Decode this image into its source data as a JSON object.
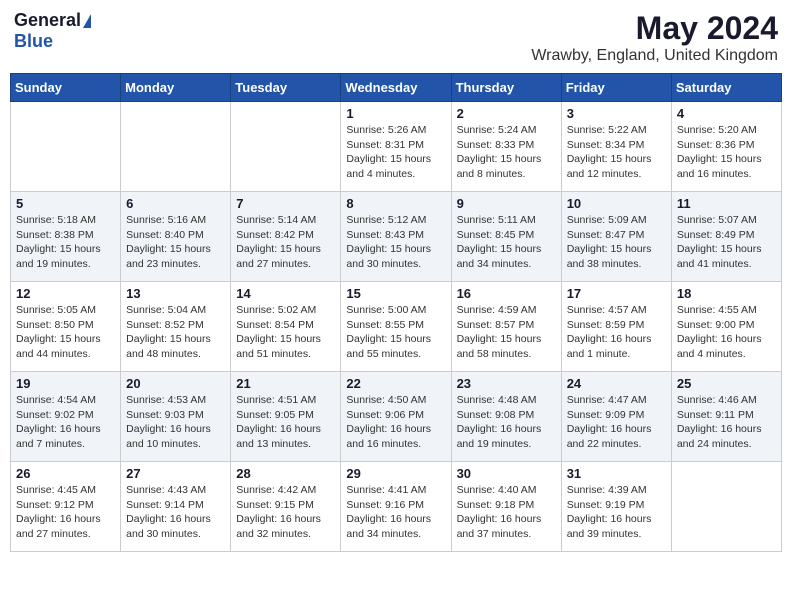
{
  "header": {
    "logo_general": "General",
    "logo_blue": "Blue",
    "month_title": "May 2024",
    "location": "Wrawby, England, United Kingdom"
  },
  "weekdays": [
    "Sunday",
    "Monday",
    "Tuesday",
    "Wednesday",
    "Thursday",
    "Friday",
    "Saturday"
  ],
  "weeks": [
    [
      {
        "day": "",
        "info": ""
      },
      {
        "day": "",
        "info": ""
      },
      {
        "day": "",
        "info": ""
      },
      {
        "day": "1",
        "info": "Sunrise: 5:26 AM\nSunset: 8:31 PM\nDaylight: 15 hours\nand 4 minutes."
      },
      {
        "day": "2",
        "info": "Sunrise: 5:24 AM\nSunset: 8:33 PM\nDaylight: 15 hours\nand 8 minutes."
      },
      {
        "day": "3",
        "info": "Sunrise: 5:22 AM\nSunset: 8:34 PM\nDaylight: 15 hours\nand 12 minutes."
      },
      {
        "day": "4",
        "info": "Sunrise: 5:20 AM\nSunset: 8:36 PM\nDaylight: 15 hours\nand 16 minutes."
      }
    ],
    [
      {
        "day": "5",
        "info": "Sunrise: 5:18 AM\nSunset: 8:38 PM\nDaylight: 15 hours\nand 19 minutes."
      },
      {
        "day": "6",
        "info": "Sunrise: 5:16 AM\nSunset: 8:40 PM\nDaylight: 15 hours\nand 23 minutes."
      },
      {
        "day": "7",
        "info": "Sunrise: 5:14 AM\nSunset: 8:42 PM\nDaylight: 15 hours\nand 27 minutes."
      },
      {
        "day": "8",
        "info": "Sunrise: 5:12 AM\nSunset: 8:43 PM\nDaylight: 15 hours\nand 30 minutes."
      },
      {
        "day": "9",
        "info": "Sunrise: 5:11 AM\nSunset: 8:45 PM\nDaylight: 15 hours\nand 34 minutes."
      },
      {
        "day": "10",
        "info": "Sunrise: 5:09 AM\nSunset: 8:47 PM\nDaylight: 15 hours\nand 38 minutes."
      },
      {
        "day": "11",
        "info": "Sunrise: 5:07 AM\nSunset: 8:49 PM\nDaylight: 15 hours\nand 41 minutes."
      }
    ],
    [
      {
        "day": "12",
        "info": "Sunrise: 5:05 AM\nSunset: 8:50 PM\nDaylight: 15 hours\nand 44 minutes."
      },
      {
        "day": "13",
        "info": "Sunrise: 5:04 AM\nSunset: 8:52 PM\nDaylight: 15 hours\nand 48 minutes."
      },
      {
        "day": "14",
        "info": "Sunrise: 5:02 AM\nSunset: 8:54 PM\nDaylight: 15 hours\nand 51 minutes."
      },
      {
        "day": "15",
        "info": "Sunrise: 5:00 AM\nSunset: 8:55 PM\nDaylight: 15 hours\nand 55 minutes."
      },
      {
        "day": "16",
        "info": "Sunrise: 4:59 AM\nSunset: 8:57 PM\nDaylight: 15 hours\nand 58 minutes."
      },
      {
        "day": "17",
        "info": "Sunrise: 4:57 AM\nSunset: 8:59 PM\nDaylight: 16 hours\nand 1 minute."
      },
      {
        "day": "18",
        "info": "Sunrise: 4:55 AM\nSunset: 9:00 PM\nDaylight: 16 hours\nand 4 minutes."
      }
    ],
    [
      {
        "day": "19",
        "info": "Sunrise: 4:54 AM\nSunset: 9:02 PM\nDaylight: 16 hours\nand 7 minutes."
      },
      {
        "day": "20",
        "info": "Sunrise: 4:53 AM\nSunset: 9:03 PM\nDaylight: 16 hours\nand 10 minutes."
      },
      {
        "day": "21",
        "info": "Sunrise: 4:51 AM\nSunset: 9:05 PM\nDaylight: 16 hours\nand 13 minutes."
      },
      {
        "day": "22",
        "info": "Sunrise: 4:50 AM\nSunset: 9:06 PM\nDaylight: 16 hours\nand 16 minutes."
      },
      {
        "day": "23",
        "info": "Sunrise: 4:48 AM\nSunset: 9:08 PM\nDaylight: 16 hours\nand 19 minutes."
      },
      {
        "day": "24",
        "info": "Sunrise: 4:47 AM\nSunset: 9:09 PM\nDaylight: 16 hours\nand 22 minutes."
      },
      {
        "day": "25",
        "info": "Sunrise: 4:46 AM\nSunset: 9:11 PM\nDaylight: 16 hours\nand 24 minutes."
      }
    ],
    [
      {
        "day": "26",
        "info": "Sunrise: 4:45 AM\nSunset: 9:12 PM\nDaylight: 16 hours\nand 27 minutes."
      },
      {
        "day": "27",
        "info": "Sunrise: 4:43 AM\nSunset: 9:14 PM\nDaylight: 16 hours\nand 30 minutes."
      },
      {
        "day": "28",
        "info": "Sunrise: 4:42 AM\nSunset: 9:15 PM\nDaylight: 16 hours\nand 32 minutes."
      },
      {
        "day": "29",
        "info": "Sunrise: 4:41 AM\nSunset: 9:16 PM\nDaylight: 16 hours\nand 34 minutes."
      },
      {
        "day": "30",
        "info": "Sunrise: 4:40 AM\nSunset: 9:18 PM\nDaylight: 16 hours\nand 37 minutes."
      },
      {
        "day": "31",
        "info": "Sunrise: 4:39 AM\nSunset: 9:19 PM\nDaylight: 16 hours\nand 39 minutes."
      },
      {
        "day": "",
        "info": ""
      }
    ]
  ]
}
